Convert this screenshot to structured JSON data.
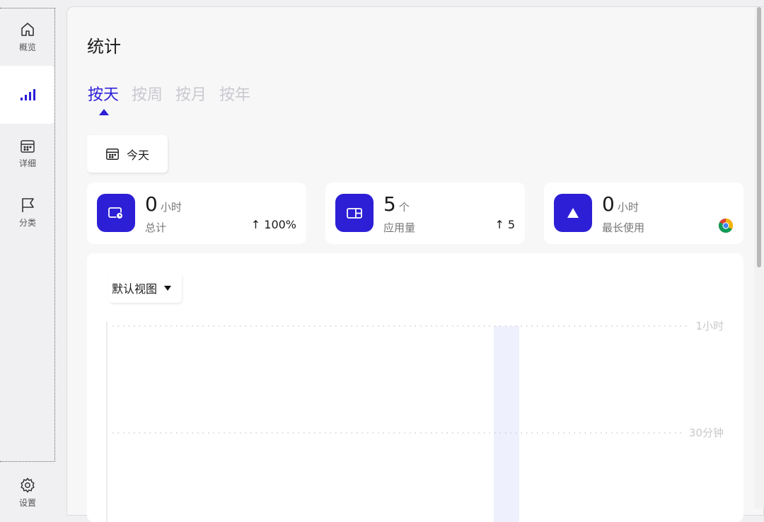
{
  "sidebar": {
    "items": [
      {
        "label": "概览",
        "icon": "home-icon"
      },
      {
        "label": "",
        "icon": "bar-chart-icon"
      },
      {
        "label": "详细",
        "icon": "calendar-icon"
      },
      {
        "label": "分类",
        "icon": "flag-icon"
      }
    ],
    "settings_label": "设置"
  },
  "page": {
    "title": "统计",
    "tabs": [
      "按天",
      "按周",
      "按月",
      "按年"
    ],
    "active_tab": "按天",
    "date_button": "今天"
  },
  "stats": [
    {
      "value": "0",
      "unit": "小时",
      "label": "总计",
      "delta": "↑ 100%",
      "icon": "clock-window-icon"
    },
    {
      "value": "5",
      "unit": "个",
      "label": "应用量",
      "delta": "↑ 5",
      "icon": "app-window-icon"
    },
    {
      "value": "0",
      "unit": "小时",
      "label": "最长使用",
      "delta": "",
      "icon": "triangle-icon",
      "app_icon": "chrome-icon"
    }
  ],
  "chart": {
    "view_select": "默认视图",
    "y_ticks": [
      "1小时",
      "30分钟"
    ]
  },
  "colors": {
    "accent": "#2c1fd6",
    "highlight_column": "#eef0fd"
  }
}
